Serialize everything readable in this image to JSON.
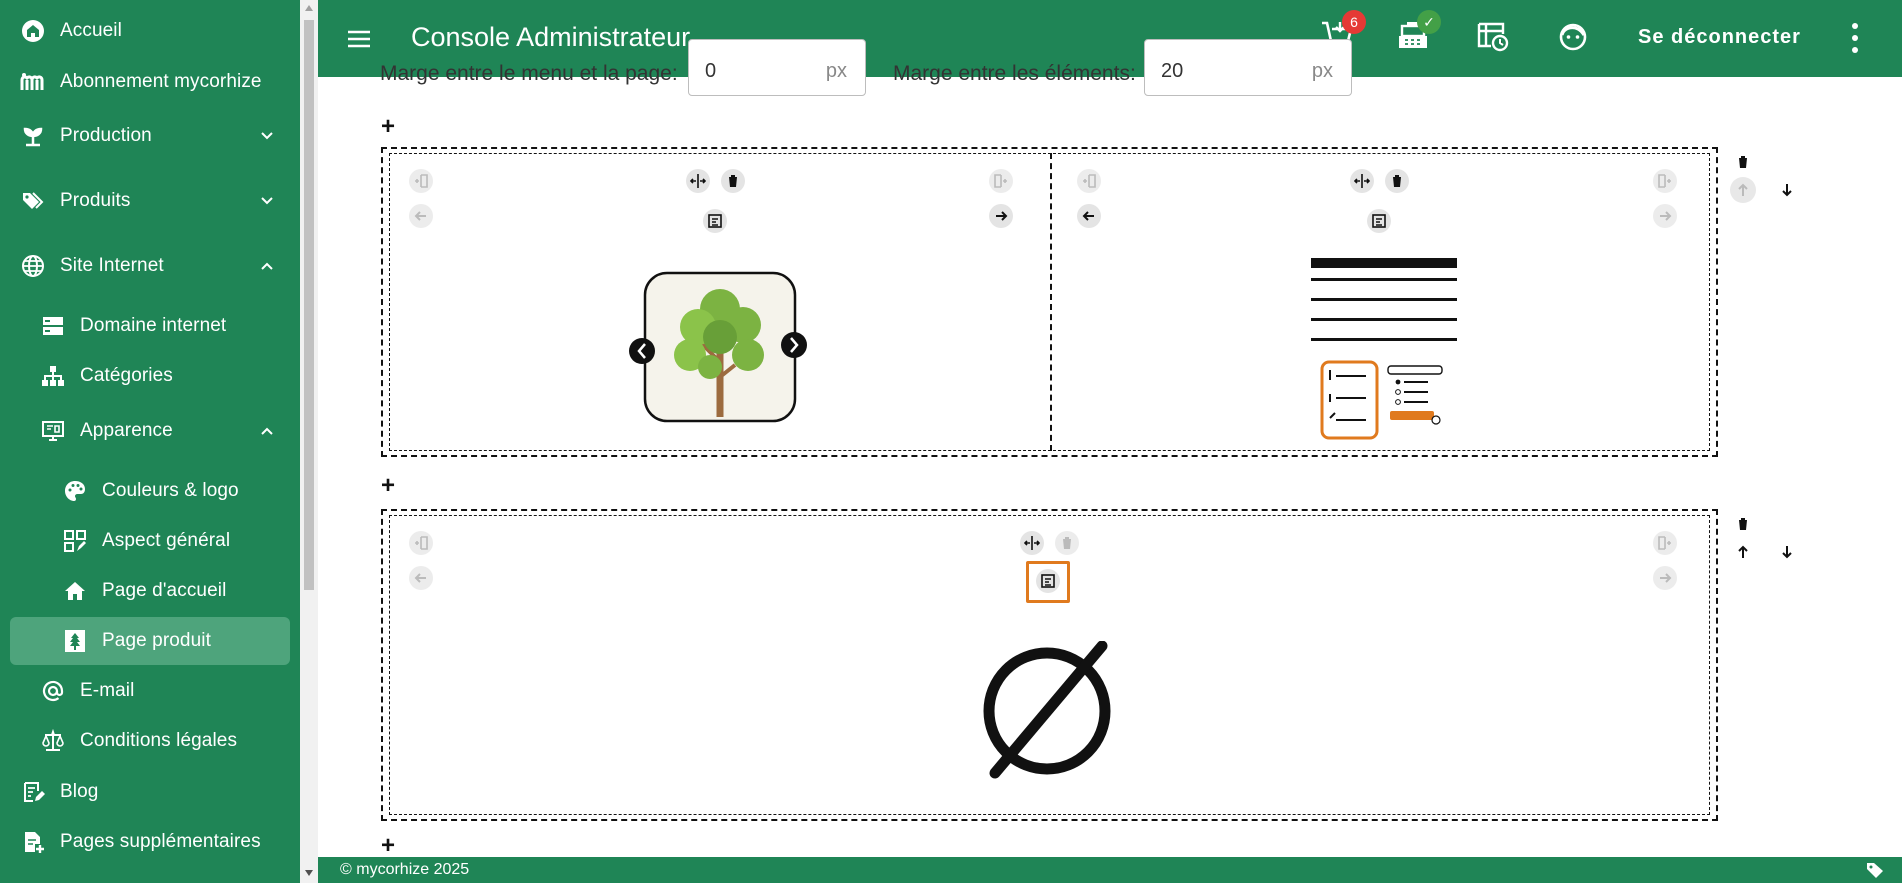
{
  "app": {
    "title": "Console Administrateur",
    "logout_label": "Se déconnecter"
  },
  "colors": {
    "primary": "#1f8556",
    "active": "#4ea47c",
    "highlight": "#e07a1e",
    "badge_red": "#e53935",
    "badge_green": "#43a047"
  },
  "sidebar": {
    "items": [
      {
        "label": "Accueil",
        "icon": "home-circle-icon"
      },
      {
        "label": "Abonnement mycorhize",
        "icon": "mycorhize-logo-icon"
      },
      {
        "label": "Production",
        "icon": "sprout-icon",
        "expanded": false
      },
      {
        "label": "Produits",
        "icon": "tags-icon",
        "expanded": false
      },
      {
        "label": "Site Internet",
        "icon": "globe-icon",
        "expanded": true
      },
      {
        "label": "Domaine internet",
        "icon": "server-icon"
      },
      {
        "label": "Catégories",
        "icon": "sitemap-icon"
      },
      {
        "label": "Apparence",
        "icon": "monitor-icon",
        "expanded": true
      },
      {
        "label": "Couleurs & logo",
        "icon": "palette-icon"
      },
      {
        "label": "Aspect général",
        "icon": "layout-icon"
      },
      {
        "label": "Page d'accueil",
        "icon": "house-icon"
      },
      {
        "label": "Page produit",
        "icon": "tree-page-icon",
        "active": true
      },
      {
        "label": "E-mail",
        "icon": "at-icon"
      },
      {
        "label": "Conditions légales",
        "icon": "scale-icon"
      },
      {
        "label": "Blog",
        "icon": "blog-edit-icon"
      },
      {
        "label": "Pages supplémentaires",
        "icon": "page-add-icon"
      }
    ]
  },
  "topbar": {
    "cart_badge": "6",
    "register_badge": "✓",
    "icons": [
      "cart-download-icon",
      "cash-register-icon",
      "calendar-clock-icon",
      "support-face-icon",
      "more-vert-icon"
    ]
  },
  "editor": {
    "margin_menu_label": "Marge entre le menu et la page:",
    "margin_menu_value": "0",
    "margin_elements_label": "Marge entre les éléments:",
    "margin_elements_value": "20",
    "unit": "px",
    "add_symbol": "+"
  },
  "footer": {
    "copyright": "© mycorhize 2025"
  }
}
